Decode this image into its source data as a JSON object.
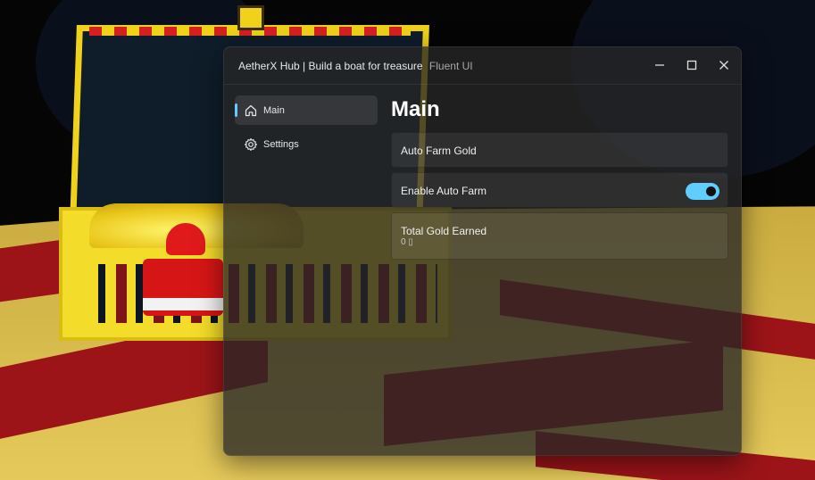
{
  "window": {
    "title": "AetherX Hub | Build a boat for treasure",
    "subtitle": "Fluent UI",
    "accent_color": "#60cdff",
    "controls": [
      "minimize-icon",
      "maximize-icon",
      "close-icon"
    ]
  },
  "sidebar": {
    "items": [
      {
        "label": "Main",
        "icon": "home-icon",
        "active": true
      },
      {
        "label": "Settings",
        "icon": "gear-icon",
        "active": false
      }
    ]
  },
  "main": {
    "title": "Main",
    "elements": [
      {
        "type": "button",
        "title": "Auto Farm Gold"
      },
      {
        "type": "toggle",
        "title": "Enable Auto Farm",
        "value": true
      },
      {
        "type": "paragraph",
        "title": "Total Gold Earned",
        "content": "0 ▯"
      }
    ]
  }
}
